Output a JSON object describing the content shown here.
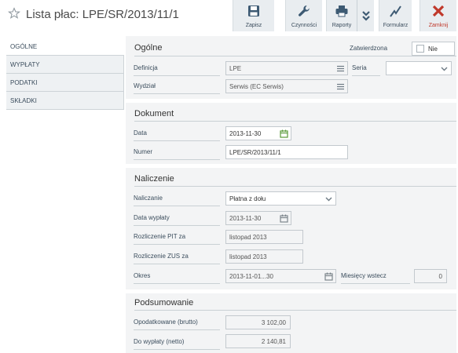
{
  "header": {
    "title": "Lista płac: LPE/SR/2013/11/1"
  },
  "toolbar": {
    "save_label": "Zapisz",
    "actions_label": "Czynności",
    "reports_label": "Raporty",
    "form_label": "Formularz",
    "close_label": "Zamknij"
  },
  "nav": {
    "items": [
      {
        "label": "OGÓLNE",
        "active": true
      },
      {
        "label": "WYPŁATY"
      },
      {
        "label": "PODATKI"
      },
      {
        "label": "SKŁADKI"
      }
    ]
  },
  "ogolne": {
    "title": "Ogólne",
    "zatwierdzona_label": "Zatwierdzona",
    "zatwierdzona_value": "Nie",
    "definicja_label": "Definicja",
    "definicja_value": "LPE",
    "seria_label": "Seria",
    "seria_value": "",
    "wydzial_label": "Wydział",
    "wydzial_value": "Serwis (EC Serwis)"
  },
  "dokument": {
    "title": "Dokument",
    "data_label": "Data",
    "data_value": "2013-11-30",
    "numer_label": "Numer",
    "numer_value": "LPE/SR/2013/11/1"
  },
  "naliczenie": {
    "title": "Naliczenie",
    "naliczanie_label": "Naliczanie",
    "naliczanie_value": "Płatna z dołu",
    "data_wyplaty_label": "Data wypłaty",
    "data_wyplaty_value": "2013-11-30",
    "pit_label": "Rozliczenie PIT za",
    "pit_value": "listopad 2013",
    "zus_label": "Rozliczenie ZUS za",
    "zus_value": "listopad 2013",
    "okres_label": "Okres",
    "okres_value": "2013-11-01...30",
    "miesiecy_label": "Miesięcy wstecz",
    "miesiecy_value": "0"
  },
  "podsumowanie": {
    "title": "Podsumowanie",
    "brutto_label": "Opodatkowane (brutto)",
    "brutto_value": "3 102,00",
    "netto_label": "Do wypłaty (netto)",
    "netto_value": "2 140,81"
  },
  "colors": {
    "close_red": "#c0392b",
    "toolbar_bg": "#e9edf0",
    "panel_bg": "#f3f4f5",
    "icon_blue": "#3d5a73",
    "calendar_green": "#5a9a3a"
  }
}
